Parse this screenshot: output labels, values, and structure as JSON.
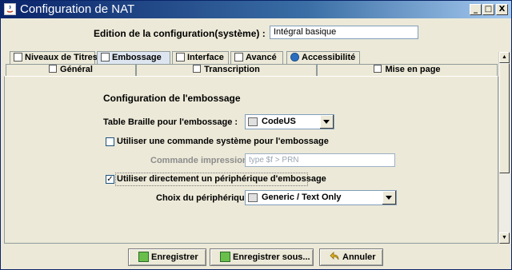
{
  "window": {
    "title": "Configuration de NAT",
    "title_color": "#ffffff",
    "titlebar_gradient": [
      "#0a246a",
      "#a6caf0"
    ],
    "controls": [
      "_",
      "□",
      "X"
    ]
  },
  "edition": {
    "label": "Edition de la configuration(système) :",
    "value": "Intégral basique"
  },
  "tabs_row1": [
    {
      "label": "Niveaux de Titres",
      "icon": "document-icon",
      "selected": false
    },
    {
      "label": "Embossage",
      "icon": "embosser-icon",
      "selected": true
    },
    {
      "label": "Interface",
      "icon": "interface-icon",
      "selected": false
    },
    {
      "label": "Avancé",
      "icon": "advanced-icon",
      "selected": false
    },
    {
      "label": "Accessibilité",
      "icon": "accessibility-icon",
      "selected": false
    }
  ],
  "tabs_row2": [
    {
      "label": "Général",
      "icon": "document-icon"
    },
    {
      "label": "Transcription",
      "icon": "document-icon"
    },
    {
      "label": "Mise en page",
      "icon": "document-icon"
    }
  ],
  "section": {
    "title": "Configuration de l'embossage",
    "braille_table_label": "Table Braille pour l'embossage :",
    "braille_table_value": "CodeUS",
    "use_system_command_label": "Utiliser une commande système pour l'embossage",
    "use_system_command_checked": false,
    "print_command_label": "Commande impression :",
    "print_command_value": "type $f > PRN",
    "use_device_label": "Utiliser directement un périphérique d'embossage",
    "use_device_checked": true,
    "device_choice_label": "Choix du périphérique :",
    "device_choice_value": "Generic / Text Only"
  },
  "buttons": {
    "save": "Enregistrer",
    "save_as": "Enregistrer sous...",
    "cancel": "Annuler"
  },
  "colors": {
    "background": "#ece9d8",
    "selected_tab": "#dde6f0",
    "field_border": "#7f9db9"
  }
}
